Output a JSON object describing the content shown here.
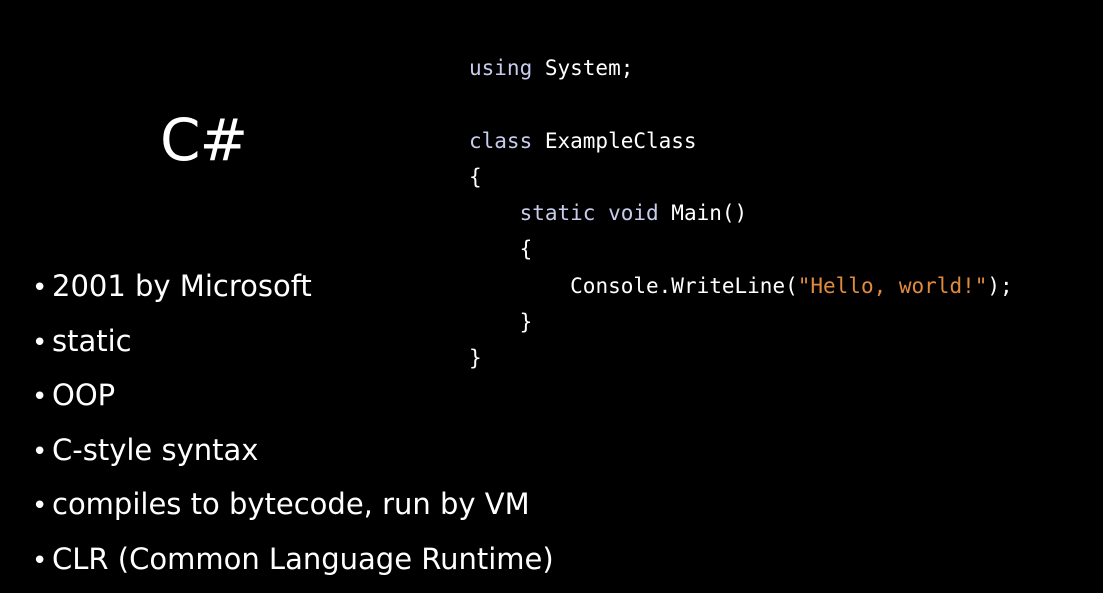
{
  "slide": {
    "title": "C#",
    "bullets": [
      "2001 by Microsoft",
      "static",
      "OOP",
      "C-style syntax",
      "compiles to bytecode, run by VM",
      "CLR (Common Language Runtime)"
    ]
  },
  "code": {
    "line1_kw": "using",
    "line1_rest": " System;",
    "line3_kw": "class",
    "line3_rest": " ExampleClass",
    "line4": "{",
    "line5_kw": "static void",
    "line5_rest": " Main()",
    "line6": "{",
    "line7_pre": "Console.WriteLine(",
    "line7_str": "\"Hello, world!\"",
    "line7_post": ");",
    "line8": "}",
    "line9": "}"
  },
  "colors": {
    "background": "#000000",
    "text": "#ffffff",
    "keyword": "#c8ccec",
    "string": "#e08a3c"
  }
}
